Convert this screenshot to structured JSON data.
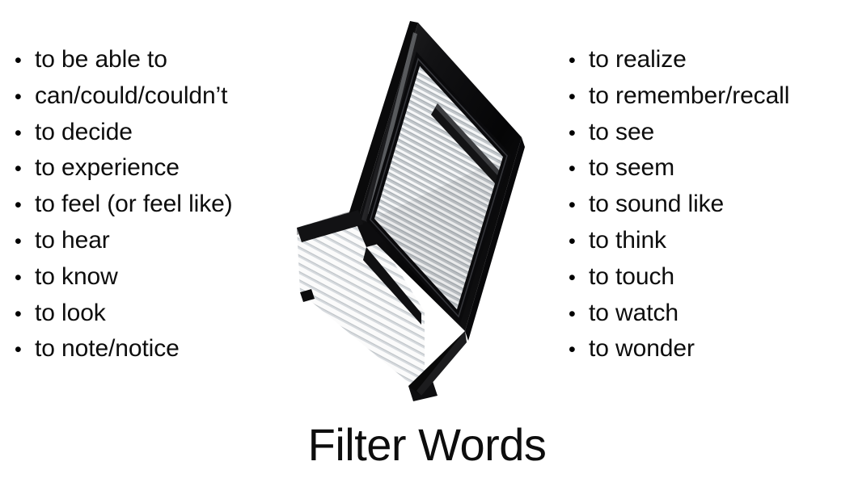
{
  "title": "Filter Words",
  "background_color": "#ffffff",
  "text_color": "#0d0d0d",
  "bullet_glyph": "•",
  "left_column": {
    "items": [
      "to be able to",
      "can/could/couldn’t",
      "to decide",
      "to experience",
      "to feel (or feel like)",
      "to hear",
      "to know",
      "to look",
      "to note/notice"
    ]
  },
  "right_column": {
    "items": [
      "to realize",
      "to remember/recall",
      "to see",
      "to seem",
      "to sound like",
      "to think",
      "to touch",
      "to watch",
      "to wonder"
    ]
  },
  "illustration": {
    "name": "air-filter-photo",
    "description": "Automotive panel air filter shown at an angle, black molded frame with white pleated filter media",
    "frame_color": "#121212",
    "media_color": "#f2f2f2",
    "pleat_shadow_color": "#9aa0a4"
  }
}
